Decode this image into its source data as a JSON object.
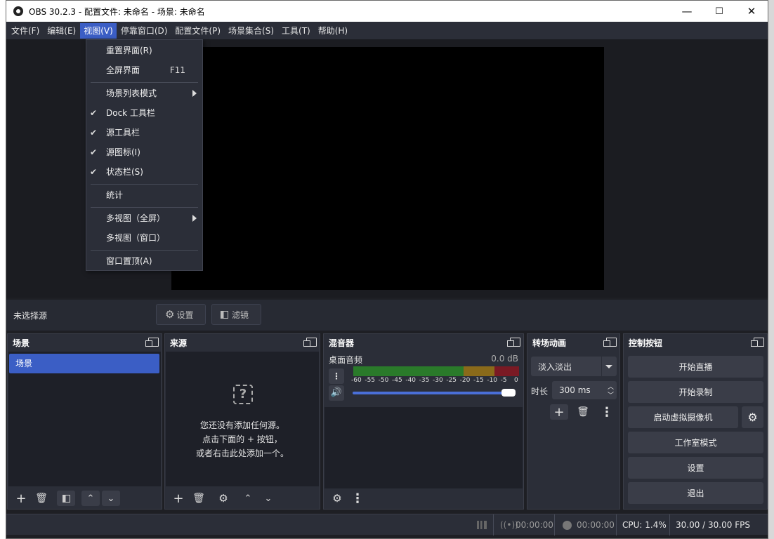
{
  "window": {
    "title": "OBS 30.2.3 - 配置文件: 未命名 - 场景: 未命名",
    "minimize": "—",
    "maximize": "☐",
    "close": "✕"
  },
  "menubar": {
    "items": [
      "文件(F)",
      "编辑(E)",
      "视图(V)",
      "停靠窗口(D)",
      "配置文件(P)",
      "场景集合(S)",
      "工具(T)",
      "帮助(H)"
    ]
  },
  "view_menu": {
    "reset_ui": "重置界面(R)",
    "fullscreen": "全屏界面",
    "fullscreen_shortcut": "F11",
    "scene_list_mode": "场景列表模式",
    "dock_toolbar": "Dock 工具栏",
    "source_toolbar": "源工具栏",
    "source_icons": "源图标(I)",
    "status_bar": "状态栏(S)",
    "stats": "统计",
    "multiview_full": "多视图（全屏）",
    "multiview_window": "多视图（窗口）",
    "always_on_top": "窗口置顶(A)"
  },
  "source_toolbar": {
    "no_source": "未选择源",
    "settings": "设置",
    "filters": "滤镜"
  },
  "scenes_dock": {
    "title": "场景",
    "items": [
      "场景"
    ]
  },
  "sources_dock": {
    "title": "来源",
    "empty_line1": "您还没有添加任何源。",
    "empty_line2": "点击下面的 + 按钮，",
    "empty_line3": "或者右击此处添加一个。"
  },
  "mixer_dock": {
    "title": "混音器",
    "channel": "桌面音频",
    "level": "0.0 dB",
    "volume_fraction": 1.0,
    "ticks": [
      "-60",
      "-55",
      "-50",
      "-45",
      "-40",
      "-35",
      "-30",
      "-25",
      "-20",
      "-15",
      "-10",
      "-5",
      "0"
    ]
  },
  "transitions_dock": {
    "title": "转场动画",
    "selected": "淡入淡出",
    "duration_label": "时长",
    "duration": "300 ms"
  },
  "controls_dock": {
    "title": "控制按钮",
    "start_stream": "开始直播",
    "start_record": "开始录制",
    "virtual_cam": "启动虚拟摄像机",
    "studio_mode": "工作室模式",
    "settings": "设置",
    "exit": "退出"
  },
  "statusbar": {
    "stream_time": "00:00:00",
    "record_time": "00:00:00",
    "cpu": "CPU: 1.4%",
    "fps": "30.00 / 30.00 FPS"
  },
  "colors": {
    "accent": "#3b5ec5",
    "panel": "#2b2e38",
    "bg": "#1e1f24",
    "meter_green": "#2a7a2a",
    "meter_yellow": "#8a6a1a",
    "meter_red": "#7a1a24"
  }
}
